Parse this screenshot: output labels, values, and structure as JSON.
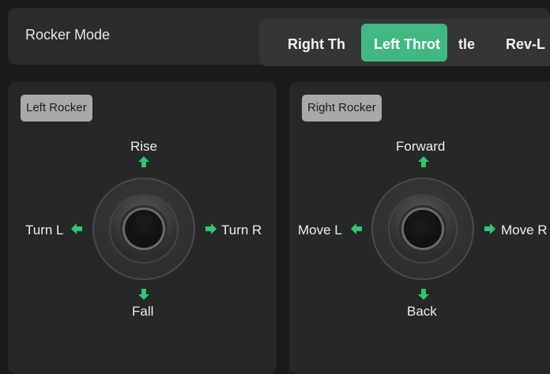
{
  "topbar": {
    "title": "Rocker Mode",
    "modes": [
      "Right Th",
      "Left Throt",
      "tle",
      "Rev-L"
    ],
    "selected_mode": "Left Throt"
  },
  "left_panel": {
    "badge": "Left Rocker",
    "up": "Rise",
    "down": "Fall",
    "left": "Turn L",
    "right": "Turn R"
  },
  "right_panel": {
    "badge": "Right Rocker",
    "up": "Forward",
    "down": "Back",
    "left": "Move L",
    "right": "Move R"
  },
  "colors": {
    "accent": "#41b882",
    "arrow": "#2fc86f"
  }
}
